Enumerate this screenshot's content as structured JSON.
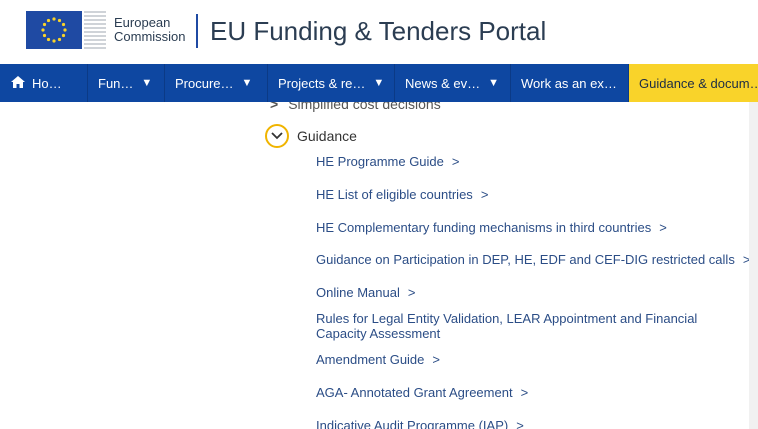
{
  "header": {
    "ec_line1": "European",
    "ec_line2": "Commission",
    "portal_title": "EU Funding & Tenders Portal"
  },
  "nav": {
    "items": [
      {
        "label": "Ho…",
        "caret": false
      },
      {
        "label": "Fun…",
        "caret": true
      },
      {
        "label": "Procure…",
        "caret": true
      },
      {
        "label": "Projects & re…",
        "caret": true
      },
      {
        "label": "News & ev…",
        "caret": true
      },
      {
        "label": "Work as an ex…",
        "caret": false
      },
      {
        "label": "Guidance & docum…",
        "caret": false
      }
    ]
  },
  "content": {
    "faded_item": "Simplified cost decisions",
    "section_label": "Guidance",
    "links": [
      "HE Programme Guide",
      "HE List of eligible countries",
      "HE Complementary funding mechanisms in third countries",
      "Guidance on Participation in DEP, HE, EDF and CEF-DIG restricted calls",
      "Online Manual",
      "Rules for Legal Entity Validation, LEAR Appointment and Financial Capacity Assessment",
      "Amendment Guide",
      "AGA- Annotated Grant Agreement",
      "Indicative Audit Programme (IAP)"
    ]
  },
  "colors": {
    "nav_bg": "#0e47a1",
    "nav_active": "#f9d32a",
    "link": "#2b4d86",
    "circle": "#f0b400"
  }
}
